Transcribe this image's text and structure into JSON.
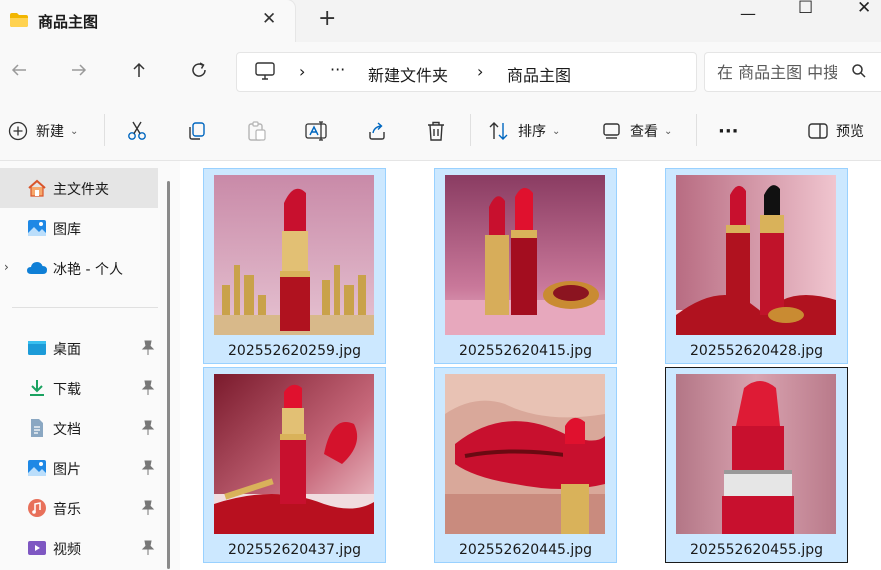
{
  "tab": {
    "title": "商品主图",
    "close": "✕",
    "new_tab": "+"
  },
  "window": {
    "minimize": "—",
    "maximize": "☐",
    "close": "✕"
  },
  "address": {
    "more": "···",
    "separator": "›",
    "crumbs": [
      "新建文件夹",
      "商品主图"
    ]
  },
  "search": {
    "placeholder": "在 商品主图 中搜索"
  },
  "toolbar": {
    "new_label": "新建",
    "sort_label": "排序",
    "view_label": "查看",
    "more_label": "···",
    "preview_label": "预览",
    "caret": "⌄"
  },
  "sidebar": {
    "items": [
      {
        "label": "主文件夹",
        "icon": "home-icon"
      },
      {
        "label": "图库",
        "icon": "gallery-icon"
      },
      {
        "label": "冰艳 - 个人",
        "icon": "onedrive-cloud-icon"
      },
      {
        "label": "桌面",
        "icon": "desktop-icon"
      },
      {
        "label": "下载",
        "icon": "download-icon"
      },
      {
        "label": "文档",
        "icon": "document-icon"
      },
      {
        "label": "图片",
        "icon": "pictures-icon"
      },
      {
        "label": "音乐",
        "icon": "music-icon"
      },
      {
        "label": "视频",
        "icon": "video-icon"
      }
    ],
    "expand_glyph": "›"
  },
  "files": [
    {
      "name": "202552620259.jpg"
    },
    {
      "name": "202552620415.jpg"
    },
    {
      "name": "202552620428.jpg"
    },
    {
      "name": "202552620437.jpg"
    },
    {
      "name": "202552620445.jpg"
    },
    {
      "name": "202552620455.jpg"
    }
  ],
  "colors": {
    "selection_bg": "#cce8ff",
    "selection_border": "#99d1ff",
    "accent_blue": "#0067c0",
    "lipstick_red": "#c8102e"
  }
}
